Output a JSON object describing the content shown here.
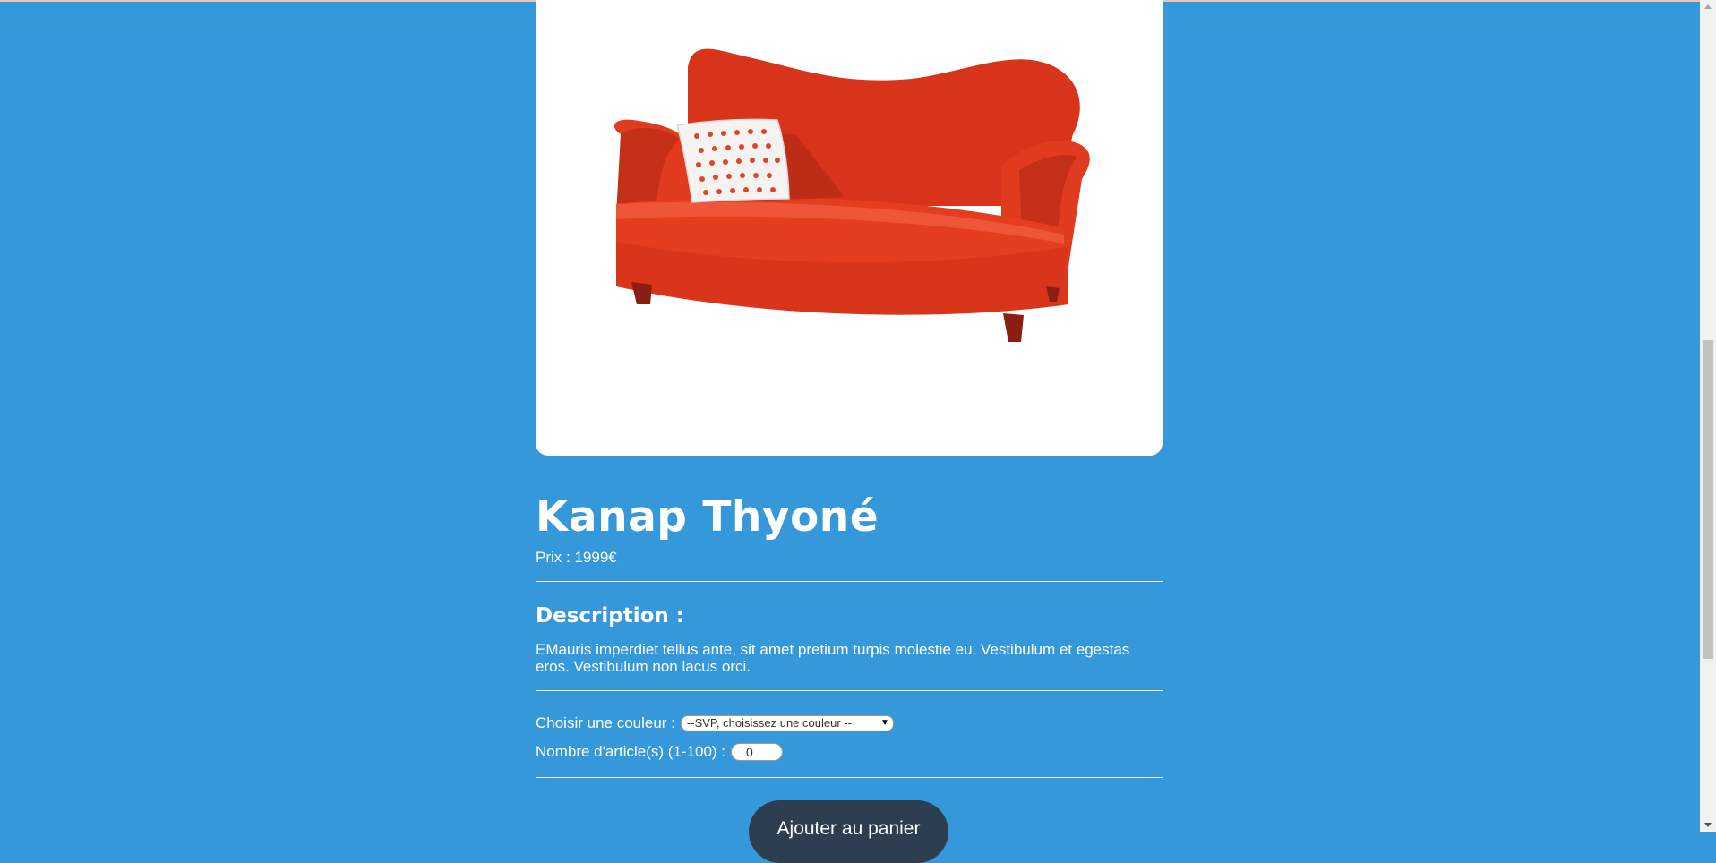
{
  "product": {
    "image_alt": "Photo d'un canapé",
    "title": "Kanap Thyoné",
    "price_label": "Prix : ",
    "price_value": "1999",
    "price_currency": "€",
    "description_title": "Description :",
    "description_text": "EMauris imperdiet tellus ante, sit amet pretium turpis molestie eu. Vestibulum et egestas eros. Vestibulum non lacus orci."
  },
  "options": {
    "color_label": "Choisir une couleur :",
    "color_selected": "--SVP, choisissez une couleur --",
    "quantity_label": "Nombre d'article(s) (1-100) :",
    "quantity_value": "0"
  },
  "actions": {
    "add_to_cart_label": "Ajouter au panier"
  },
  "colors": {
    "page_background": "#3498db",
    "button_background": "#2c3e50",
    "sofa": "#e03a1f"
  }
}
